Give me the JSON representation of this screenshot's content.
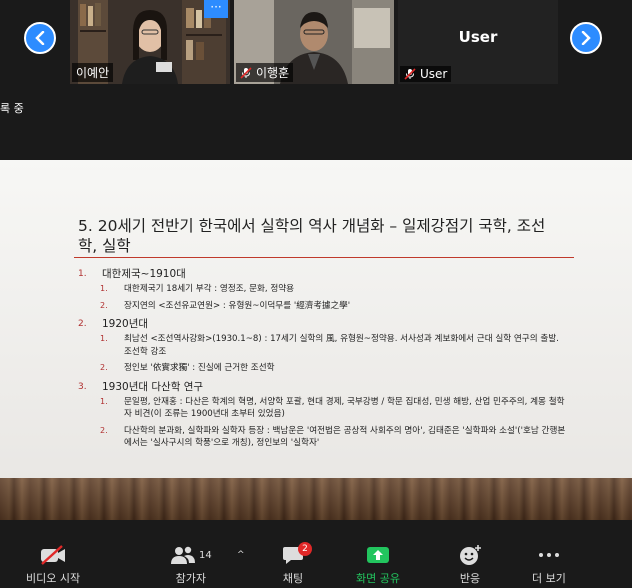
{
  "participants": [
    {
      "name": "이예안"
    },
    {
      "name": "이행훈",
      "muted": true
    },
    {
      "name": "User",
      "display_name": "User",
      "muted": true
    }
  ],
  "more_label": "···",
  "recording_label": "록 중",
  "slide": {
    "title": "5. 20세기 전반기 한국에서 실학의 역사 개념화 – 일제강점기 국학, 조선학, 실학",
    "sections": [
      {
        "num": "1.",
        "heading": "대한제국~1910대",
        "items": [
          {
            "num": "1.",
            "text": "대한제국기 18세기 부각 : 영정조, 문화, 정약용"
          },
          {
            "num": "2.",
            "text": "장지연의 <조선유교연원> : 유형원~이덕무를 '經濟考據之學'"
          }
        ]
      },
      {
        "num": "2.",
        "heading": "1920년대",
        "items": [
          {
            "num": "1.",
            "text": "최남선 <조선역사강화>(1930.1~8) : 17세기 실학의 風, 유형원~정약용. 서사성과 계보화에서 근대 실학 연구의 출발. 조선학 강조"
          },
          {
            "num": "2.",
            "text": "정인보 '依實求獨' : 진실에 근거한 조선학"
          }
        ]
      },
      {
        "num": "3.",
        "heading": "1930년대 다산학 연구",
        "items": [
          {
            "num": "1.",
            "text": "문일평, 안재홍 : 다산은 학계의 혁명, 서양학 포괄, 현대 경제, 국부강병 / 학문 집대성, 민생 해방, 산업 민주주의, 계몽 철학자 비견(이 조류는 1900년대 초부터 있었음)"
          },
          {
            "num": "2.",
            "text": "다산학의 분과화, 실학파와 실학자 등장 : 백남운은 '여전법은 공상적 사회주의 명아', 김태준은 '실학파와 소설'('호남 간행본에서는 '실사구시의 학풍'으로 개칭), 정인보의 '실학자'"
          }
        ]
      }
    ]
  },
  "toolbar": {
    "video_label": "비디오 시작",
    "participants_label": "참가자",
    "participants_count": "14",
    "chat_label": "채팅",
    "chat_badge": "2",
    "share_label": "화면 공유",
    "reactions_label": "반응",
    "more_label": "더 보기"
  },
  "colors": {
    "accent": "#2d8cff",
    "share_green": "#22c55e",
    "badge_red": "#e02828",
    "slide_accent": "#b03030"
  }
}
